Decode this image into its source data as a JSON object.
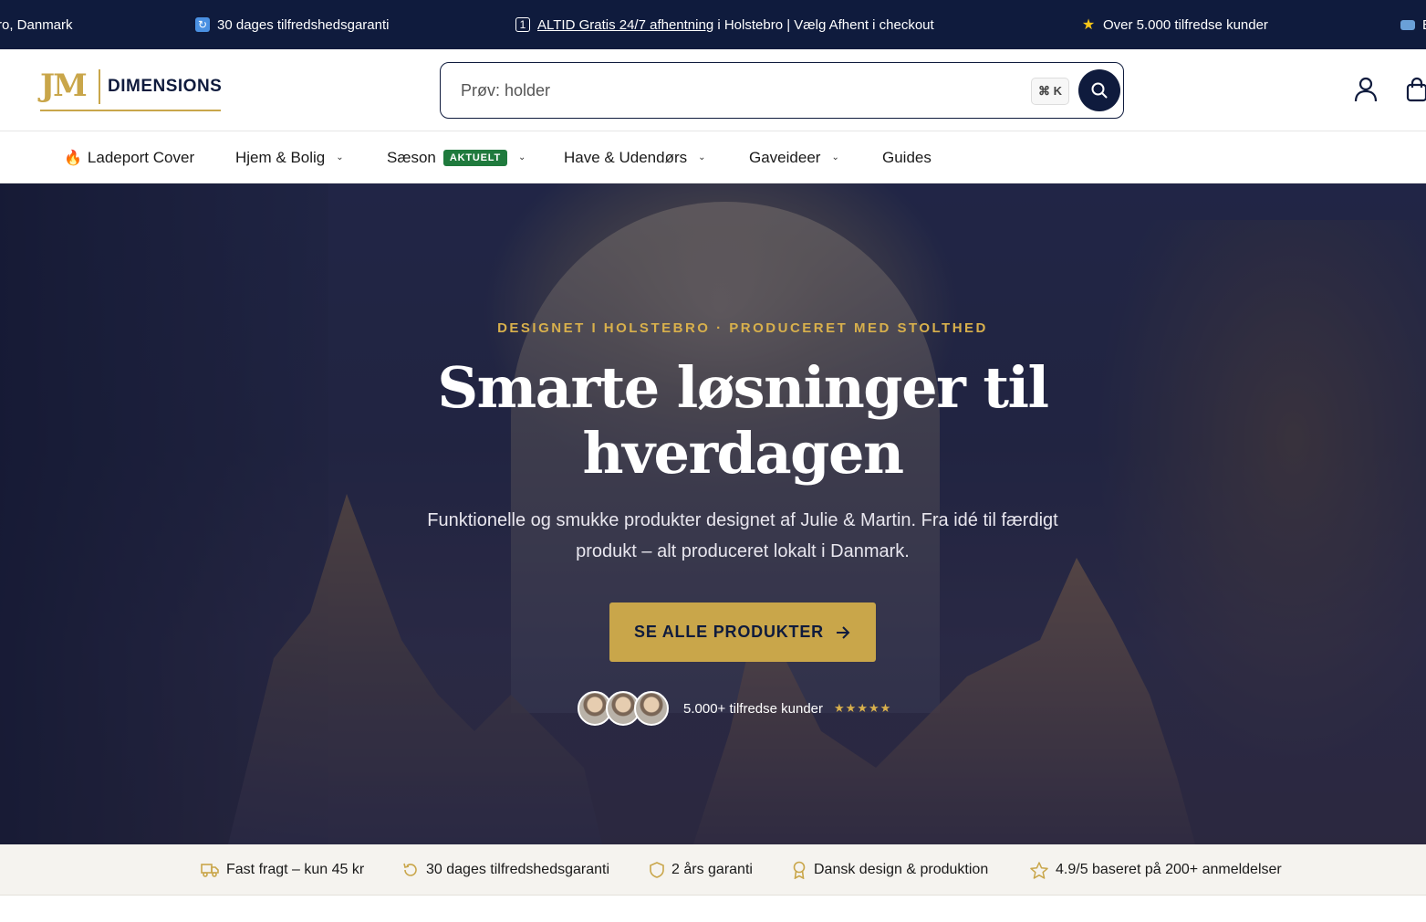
{
  "announcement": {
    "items": [
      {
        "icon": "location-icon",
        "text": "ro, Danmark"
      },
      {
        "icon": "refresh-icon",
        "text": "30 dages tilfredshedsgaranti"
      },
      {
        "icon": "one-icon",
        "link_text": "ALTID Gratis 24/7 afhentning",
        "text": " i Holstebro | Vælg Afhent i checkout"
      },
      {
        "icon": "star-icon",
        "text": "Over 5.000 tilfredse kunder"
      },
      {
        "icon": "card-icon",
        "text": "E"
      }
    ]
  },
  "header": {
    "logo_mark": "JM",
    "logo_text": "DIMENSIONS",
    "search_placeholder": "Prøv: holder",
    "search_shortcut": "⌘ K"
  },
  "nav": {
    "items": [
      {
        "label": "Ladeport Cover",
        "icon": "flame-icon"
      },
      {
        "label": "Hjem & Bolig",
        "has_dropdown": true
      },
      {
        "label": "Sæson",
        "badge": "AKTUELT",
        "has_dropdown": true
      },
      {
        "label": "Have & Udendørs",
        "has_dropdown": true
      },
      {
        "label": "Gaveideer",
        "has_dropdown": true
      },
      {
        "label": "Guides"
      }
    ]
  },
  "hero": {
    "eyebrow": "DESIGNET I HOLSTEBRO · PRODUCERET MED STOLTHED",
    "title_line1": "Smarte løsninger til",
    "title_line2": "hverdagen",
    "subtitle": "Funktionelle og smukke produkter designet af Julie & Martin. Fra idé til færdigt produkt – alt produceret lokalt i Danmark.",
    "cta_label": "SE ALLE PRODUKTER",
    "social_proof": "5.000+ tilfredse kunder",
    "stars": "★★★★★",
    "rating": 5
  },
  "trust": {
    "items": [
      {
        "icon": "truck-icon",
        "text": "Fast fragt – kun 45 kr"
      },
      {
        "icon": "return-icon",
        "text": "30 dages tilfredshedsgaranti"
      },
      {
        "icon": "shield-icon",
        "text": "2 års garanti"
      },
      {
        "icon": "award-icon",
        "text": "Dansk design & produktion"
      },
      {
        "icon": "star-outline-icon",
        "text": "4.9/5 baseret på 200+ anmeldelser"
      }
    ]
  },
  "colors": {
    "navy": "#0f1b3d",
    "gold": "#c9a64a",
    "badge_green": "#1f7a3d"
  }
}
